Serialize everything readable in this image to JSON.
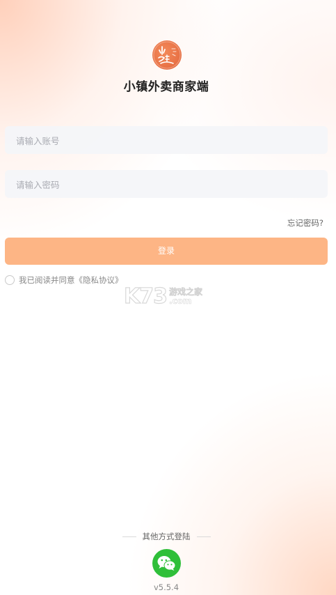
{
  "app": {
    "title": "小镇外卖商家端",
    "logo_text": "小镇外卖",
    "brand_color": "#e8693f"
  },
  "form": {
    "account_placeholder": "请输入账号",
    "account_value": "",
    "password_placeholder": "请输入密码",
    "password_value": "",
    "forgot_label": "忘记密码?",
    "login_label": "登录",
    "login_color": "#fdb585"
  },
  "agreement": {
    "checked": false,
    "prefix": "我已阅读并同意",
    "link": "《隐私协议》"
  },
  "watermark": {
    "brand": "K73",
    "line1": "游戏之家",
    "line2": ".com"
  },
  "footer": {
    "other_login_label": "其他方式登陆",
    "wechat_icon": "wechat-icon",
    "wechat_color": "#2fbf39",
    "version": "v5.5.4"
  }
}
